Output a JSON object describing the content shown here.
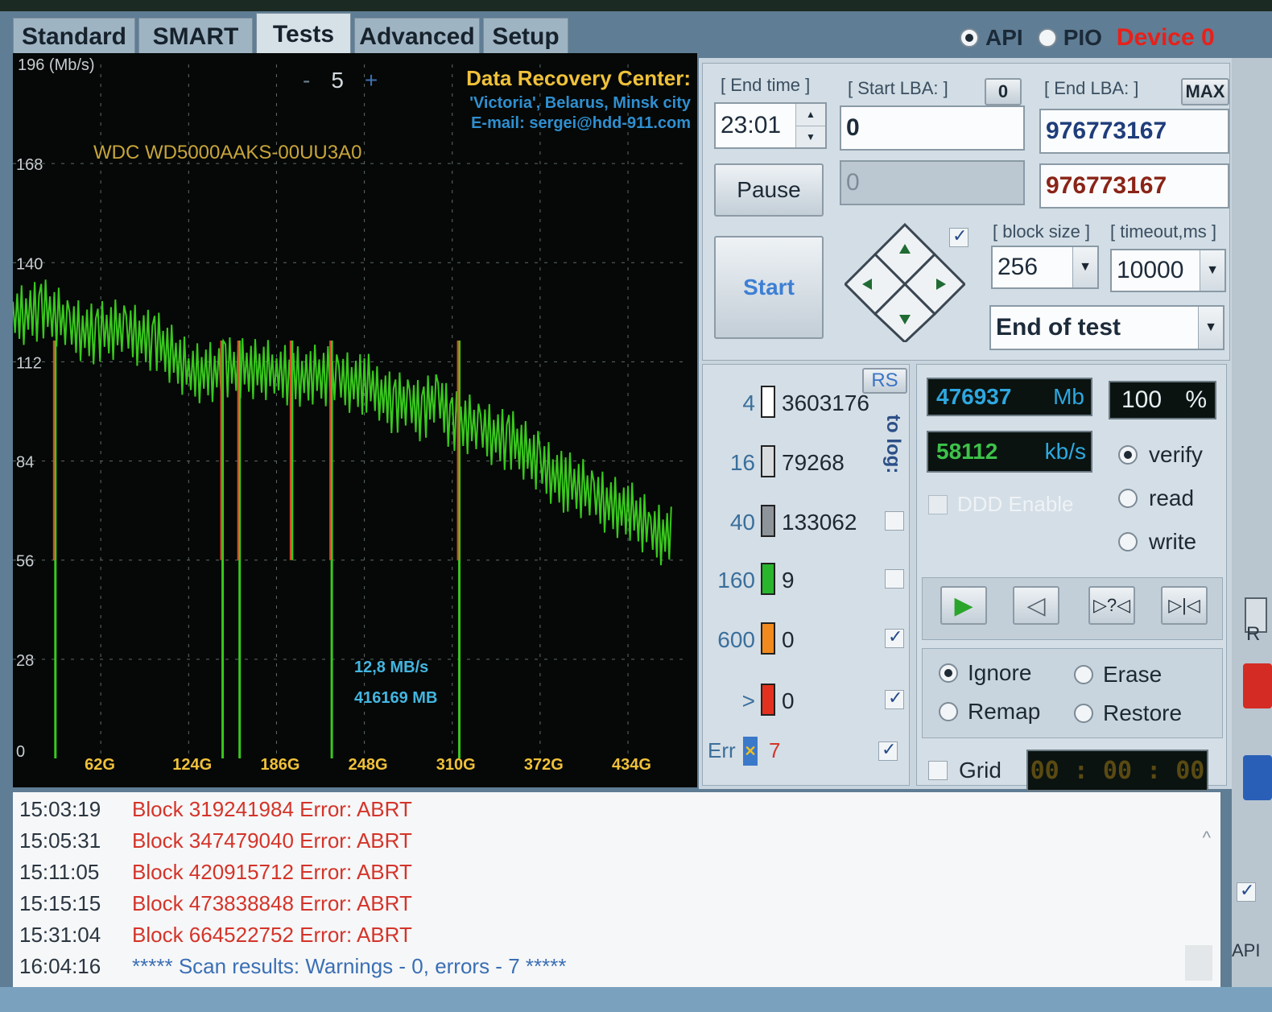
{
  "tabs": [
    "Standard",
    "SMART",
    "Tests",
    "Advanced",
    "Setup"
  ],
  "active_tab": "Tests",
  "interface": {
    "api_label": "API",
    "pio_label": "PIO",
    "selected": "API",
    "device_label": "Device 0"
  },
  "chart": {
    "y_unit_label": "196 (Mb/s)",
    "y_ticks": [
      "168",
      "140",
      "112",
      "84",
      "56",
      "28",
      "0"
    ],
    "x_ticks": [
      "62G",
      "124G",
      "186G",
      "248G",
      "310G",
      "372G",
      "434G"
    ],
    "zoom_minus": "-",
    "zoom_value": "5",
    "zoom_plus": "+",
    "drive_model": "WDC WD5000AAKS-00UU3A0",
    "credits": {
      "line1": "Data Recovery Center:",
      "line2": "'Victoria', Belarus, Minsk city",
      "line3": "E-mail: sergei@hdd-911.com"
    },
    "cursor_speed": "12,8 MB/s",
    "cursor_position": "416169 MB",
    "colors": {
      "speed_line": "#39c81e",
      "drop_marker": "#e3402a"
    }
  },
  "chart_data": {
    "type": "line",
    "title": "",
    "xlabel": "",
    "ylabel": "196 (Mb/s)",
    "xlim": [
      0,
      476
    ],
    "ylim": [
      0,
      196
    ],
    "grid": true,
    "x_ticks": [
      "62G",
      "124G",
      "186G",
      "248G",
      "310G",
      "372G",
      "434G"
    ],
    "series": [
      {
        "x": [
          0,
          20,
          40,
          60,
          80,
          100,
          124,
          150,
          186,
          210,
          230,
          248,
          260,
          270,
          280,
          290,
          300,
          310,
          330,
          350,
          372,
          390,
          410,
          434,
          450,
          466
        ],
        "values": [
          125,
          127,
          122,
          120,
          121,
          118,
          109,
          110,
          109,
          108,
          107,
          106,
          103,
          100,
          100,
          98,
          102,
          95,
          93,
          90,
          83,
          78,
          74,
          70,
          64,
          63
        ]
      }
    ],
    "drops": [
      {
        "x": 30,
        "low": 0
      },
      {
        "x": 148,
        "low": 0
      },
      {
        "x": 160,
        "low": 0
      },
      {
        "x": 197,
        "low": 56
      },
      {
        "x": 225,
        "low": 0
      },
      {
        "x": 315,
        "low": 0
      }
    ]
  },
  "controls": {
    "end_time_label": "[ End time ]",
    "end_time_value": "23:01",
    "start_lba_label": "[ Start LBA: ]",
    "start_lba_zero_btn": "0",
    "start_lba_value": "0",
    "start_lba_current": "0",
    "end_lba_label": "[ End LBA: ]",
    "end_lba_max_btn": "MAX",
    "end_lba_value": "976773167",
    "end_lba_current": "976773167",
    "pause_label": "Pause",
    "start_label": "Start",
    "block_size_label": "[ block size ]",
    "block_size_value": "256",
    "timeout_label": "[ timeout,ms ]",
    "timeout_value": "10000",
    "end_action_value": "End of test",
    "direction_checked": true
  },
  "blocks": {
    "rs_label": "RS",
    "to_log_label": "to log:",
    "rows": [
      {
        "threshold": "4",
        "count": "3603176",
        "color": "#ffffff",
        "log": null
      },
      {
        "threshold": "16",
        "count": "79268",
        "color": "#d8dcdf",
        "log": null
      },
      {
        "threshold": "40",
        "count": "133062",
        "color": "#8d949a",
        "log": false
      },
      {
        "threshold": "160",
        "count": "9",
        "color": "#29b52c",
        "log": false
      },
      {
        "threshold": "600",
        "count": "0",
        "color": "#f08a1e",
        "log": true
      },
      {
        "threshold": ">",
        "count": "0",
        "color": "#e2321f",
        "log": true
      }
    ],
    "err_label": "Err",
    "err_count": "7",
    "err_log": true
  },
  "stats": {
    "size_value": "476937",
    "size_unit": "Mb",
    "percent_value": "100",
    "percent_unit": "%",
    "speed_value": "58112",
    "speed_unit": "kb/s",
    "ddd_label": "DDD Enable",
    "modes": [
      "verify",
      "read",
      "write"
    ],
    "selected_mode": "verify",
    "actions": [
      "Ignore",
      "Erase",
      "Remap",
      "Restore"
    ],
    "selected_action": "Ignore",
    "grid_label": "Grid",
    "timer": "00 : 00 : 00"
  },
  "log": [
    {
      "time": "15:03:19",
      "text": "Block 319241984 Error: ABRT",
      "kind": "err"
    },
    {
      "time": "15:05:31",
      "text": "Block 347479040 Error: ABRT",
      "kind": "err"
    },
    {
      "time": "15:11:05",
      "text": "Block 420915712 Error: ABRT",
      "kind": "err"
    },
    {
      "time": "15:15:15",
      "text": "Block 473838848 Error: ABRT",
      "kind": "err"
    },
    {
      "time": "15:31:04",
      "text": "Block 664522752 Error: ABRT",
      "kind": "err"
    },
    {
      "time": "16:04:16",
      "text": "***** Scan results: Warnings - 0, errors - 7 *****",
      "kind": "info"
    }
  ],
  "right_edge": {
    "r_label": "R",
    "api_label": "API"
  }
}
